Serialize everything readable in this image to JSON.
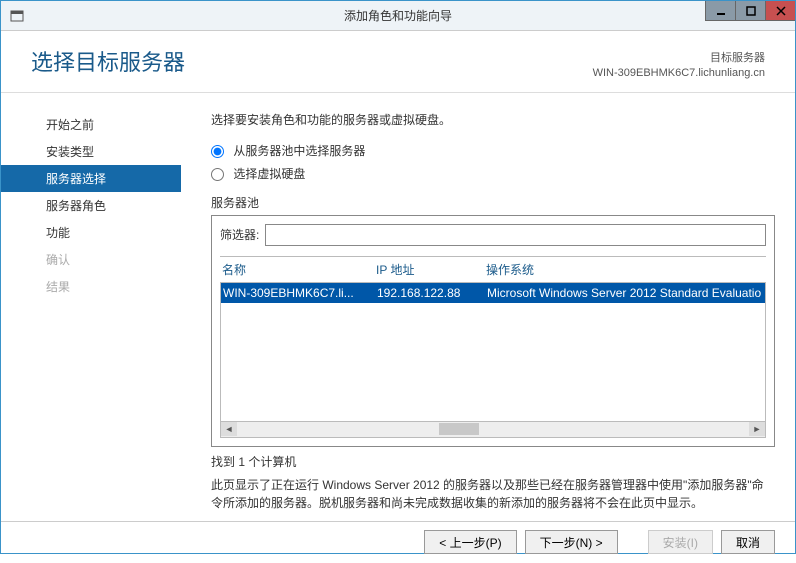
{
  "titlebar": {
    "title": "添加角色和功能向导"
  },
  "header": {
    "heading": "选择目标服务器",
    "target_label": "目标服务器",
    "target_value": "WIN-309EBHMK6C7.lichunliang.cn"
  },
  "sidebar": {
    "steps": [
      {
        "label": "开始之前",
        "state": "normal"
      },
      {
        "label": "安装类型",
        "state": "normal"
      },
      {
        "label": "服务器选择",
        "state": "active"
      },
      {
        "label": "服务器角色",
        "state": "normal"
      },
      {
        "label": "功能",
        "state": "normal"
      },
      {
        "label": "确认",
        "state": "disabled"
      },
      {
        "label": "结果",
        "state": "disabled"
      }
    ]
  },
  "content": {
    "instruction": "选择要安装角色和功能的服务器或虚拟硬盘。",
    "radio1": "从服务器池中选择服务器",
    "radio2": "选择虚拟硬盘",
    "pool_label": "服务器池",
    "filter_label": "筛选器:",
    "filter_value": "",
    "columns": {
      "name": "名称",
      "ip": "IP 地址",
      "os": "操作系统"
    },
    "rows": [
      {
        "name": "WIN-309EBHMK6C7.li...",
        "ip": "192.168.122.88",
        "os": "Microsoft Windows Server 2012 Standard Evaluatio"
      }
    ],
    "count_text": "找到 1 个计算机",
    "desc_text": "此页显示了正在运行 Windows Server 2012 的服务器以及那些已经在服务器管理器中使用\"添加服务器\"命令所添加的服务器。脱机服务器和尚未完成数据收集的新添加的服务器将不会在此页中显示。"
  },
  "footer": {
    "prev": "< 上一步(P)",
    "next": "下一步(N) >",
    "install": "安装(I)",
    "cancel": "取消"
  }
}
